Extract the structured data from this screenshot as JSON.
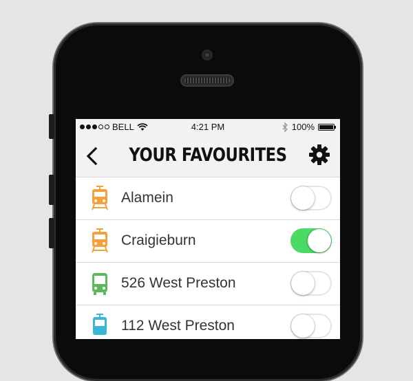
{
  "status_bar": {
    "carrier": "BELL",
    "time": "4:21 PM",
    "battery": "100%",
    "signal_bars_filled": 3,
    "signal_bars_total": 5
  },
  "header": {
    "title": "YOUR FAVOURITES",
    "back_icon": "chevron-left-icon",
    "settings_icon": "gear-icon"
  },
  "colors": {
    "train": "#f5a03a",
    "bus": "#5cb85c",
    "tram": "#3ab7d6",
    "toggle_on": "#4cd964"
  },
  "favourites": [
    {
      "label": "Alamein",
      "mode": "train",
      "enabled": false
    },
    {
      "label": "Craigieburn",
      "mode": "train",
      "enabled": true
    },
    {
      "label": "526 West Preston",
      "mode": "bus",
      "enabled": false
    },
    {
      "label": "112 West Preston",
      "mode": "tram",
      "enabled": false
    }
  ]
}
